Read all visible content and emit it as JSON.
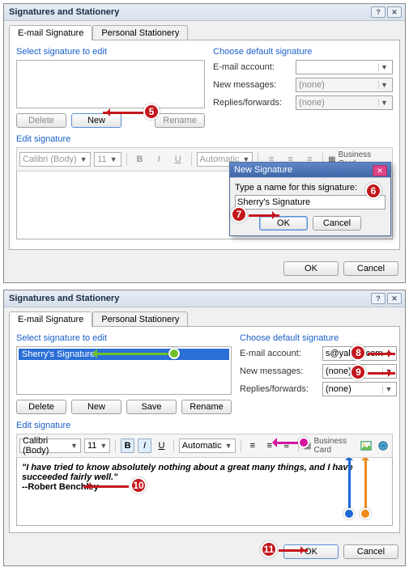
{
  "dialog_title": "Signatures and Stationery",
  "tabs": {
    "email": "E-mail Signature",
    "personal": "Personal Stationery"
  },
  "top": {
    "select_label": "Select signature to edit",
    "choose_label": "Choose default signature",
    "account_label": "E-mail account:",
    "newmsg_label": "New messages:",
    "replies_label": "Replies/forwards:",
    "account_value": "",
    "newmsg_value": "(none)",
    "replies_value": "(none)",
    "btn_delete": "Delete",
    "btn_new": "New",
    "btn_rename": "Rename",
    "btn_save": "Save",
    "edit_label": "Edit signature",
    "font": "Calibri (Body)",
    "size": "11",
    "color": "Automatic",
    "biz": "Business Card"
  },
  "inner": {
    "title": "New Signature",
    "prompt": "Type a name for this signature:",
    "value": "Sherry's Signature",
    "ok": "OK",
    "cancel": "Cancel"
  },
  "bottom": {
    "sig_name": "Sherry's Signature",
    "account_value": "s@yahoo.com",
    "newmsg_value": "(none)",
    "replies_value": "(none)",
    "quote": "\"I have tried to know absolutely nothing about a great many things, and I have succeeded fairly well.\"",
    "author": "--Robert Benchley"
  },
  "footer": {
    "ok": "OK",
    "cancel": "Cancel"
  },
  "callouts": {
    "5": "5",
    "6": "6",
    "7": "7",
    "8": "8",
    "9": "9",
    "10": "10",
    "11": "11"
  }
}
